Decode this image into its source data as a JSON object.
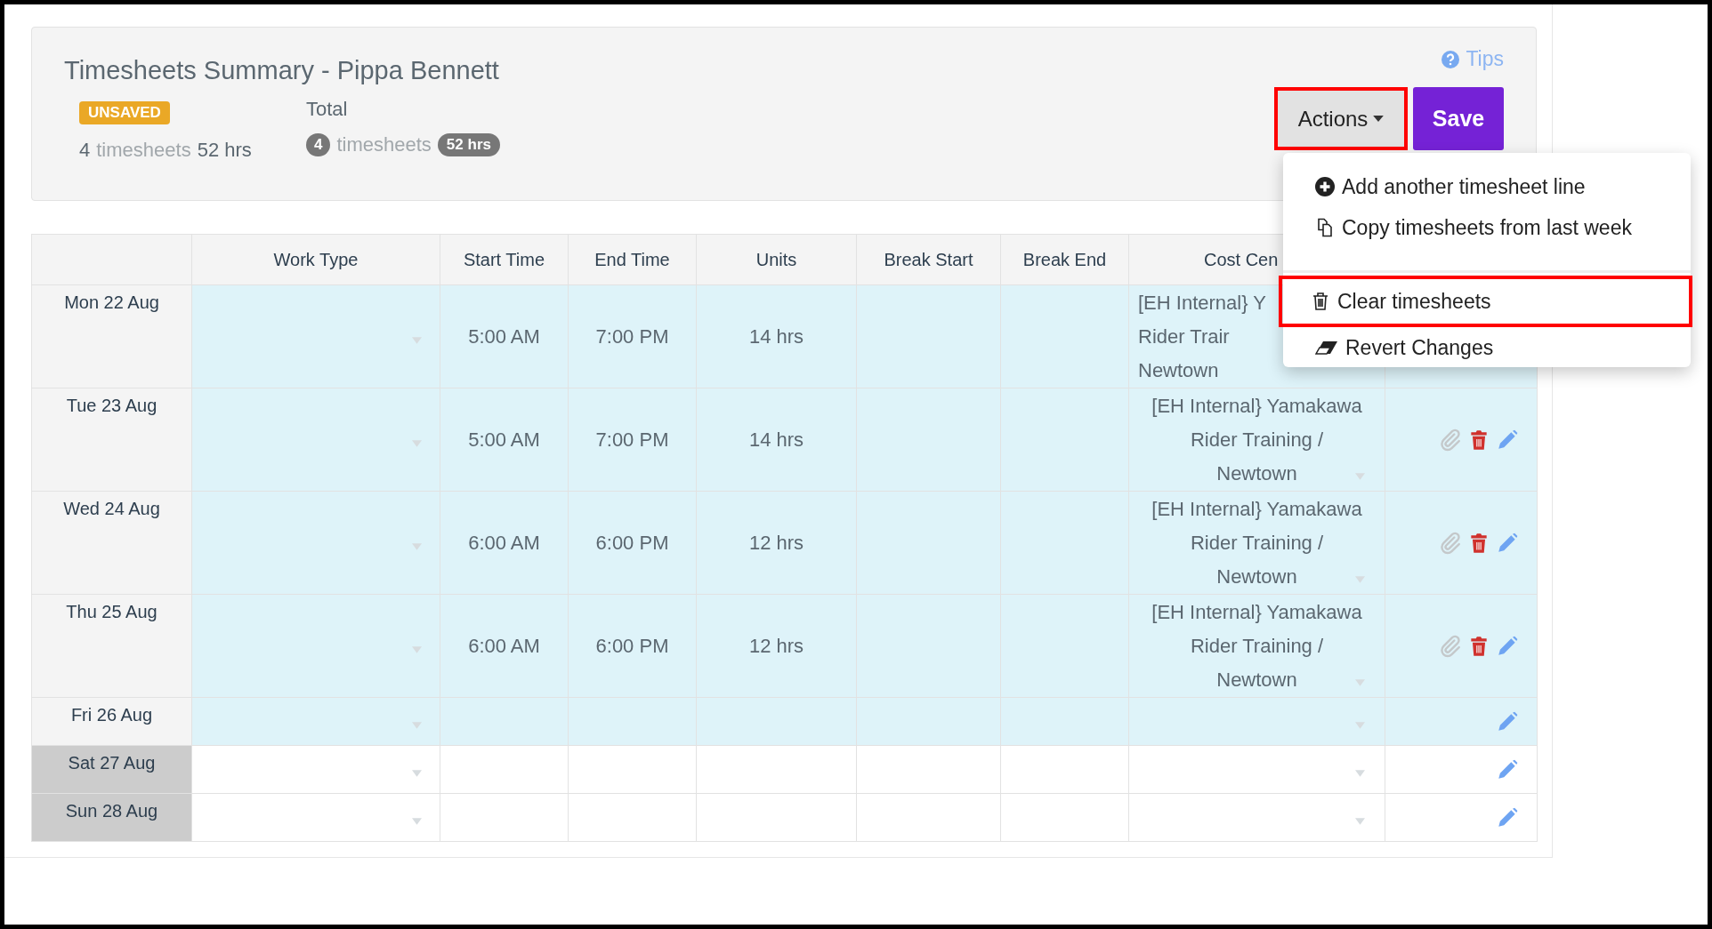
{
  "header": {
    "title": "Timesheets Summary - Pippa Bennett",
    "tips_link": "Tips",
    "status_badge": "UNSAVED",
    "summary": {
      "count": "4",
      "count_label": "timesheets",
      "hours": "52 hrs"
    },
    "total": {
      "label": "Total",
      "count": "4",
      "count_label": "timesheets",
      "hours": "52 hrs"
    },
    "actions_button": {
      "label": "Actions",
      "highlighted": true
    },
    "save_button": "Save"
  },
  "actions_menu": {
    "items": [
      {
        "kind": "add",
        "label": "Add another timesheet line",
        "highlighted": false,
        "divider_before": false
      },
      {
        "kind": "copy",
        "label": "Copy timesheets from last week",
        "highlighted": false,
        "divider_before": false
      },
      {
        "kind": "clear",
        "label": "Clear timesheets",
        "highlighted": true,
        "divider_before": true
      },
      {
        "kind": "revert",
        "label": "Revert Changes",
        "highlighted": false,
        "divider_before": false
      }
    ]
  },
  "table": {
    "columns": [
      "Work Type",
      "Start Time",
      "End Time",
      "Units",
      "Break Start",
      "Break End",
      "Cost Cen"
    ],
    "rows": [
      {
        "date": "Mon 22 Aug",
        "weekend": false,
        "start": "5:00 AM",
        "end": "7:00 PM",
        "units": "14 hrs",
        "cost_centre": [
          "[EH Internal} Y",
          "Rider Trair",
          "Newtown"
        ],
        "covered": true
      },
      {
        "date": "Tue 23 Aug",
        "weekend": false,
        "start": "5:00 AM",
        "end": "7:00 PM",
        "units": "14 hrs",
        "cost_centre": [
          "[EH Internal} Yamakawa",
          "Rider Training /",
          "Newtown"
        ],
        "covered": false,
        "attachment": true,
        "deletable": true,
        "editable": true
      },
      {
        "date": "Wed 24 Aug",
        "weekend": false,
        "start": "6:00 AM",
        "end": "6:00 PM",
        "units": "12 hrs",
        "cost_centre": [
          "[EH Internal} Yamakawa",
          "Rider Training /",
          "Newtown"
        ],
        "covered": false,
        "attachment": true,
        "deletable": true,
        "editable": true
      },
      {
        "date": "Thu 25 Aug",
        "weekend": false,
        "start": "6:00 AM",
        "end": "6:00 PM",
        "units": "12 hrs",
        "cost_centre": [
          "[EH Internal} Yamakawa",
          "Rider Training /",
          "Newtown"
        ],
        "covered": false,
        "attachment": true,
        "deletable": true,
        "editable": true
      },
      {
        "date": "Fri 26 Aug",
        "weekend": false,
        "covered": false,
        "attachment": false,
        "deletable": false,
        "editable": true
      },
      {
        "date": "Sat 27 Aug",
        "weekend": true,
        "covered": false,
        "attachment": false,
        "deletable": false,
        "editable": true
      },
      {
        "date": "Sun 28 Aug",
        "weekend": true,
        "covered": false,
        "attachment": false,
        "deletable": false,
        "editable": true
      }
    ]
  }
}
